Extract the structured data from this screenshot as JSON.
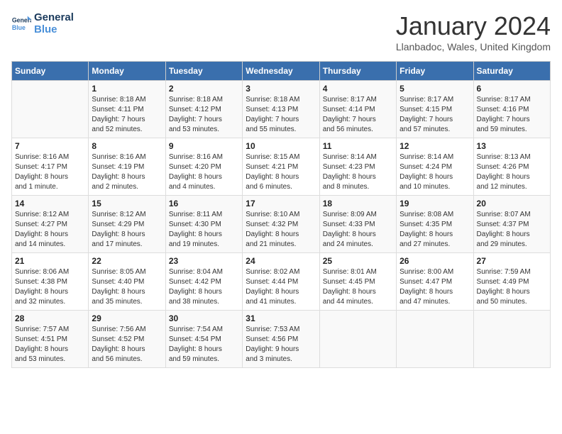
{
  "logo": {
    "line1": "General",
    "line2": "Blue"
  },
  "title": "January 2024",
  "location": "Llanbadoc, Wales, United Kingdom",
  "days_header": [
    "Sunday",
    "Monday",
    "Tuesday",
    "Wednesday",
    "Thursday",
    "Friday",
    "Saturday"
  ],
  "weeks": [
    [
      {
        "num": "",
        "info": ""
      },
      {
        "num": "1",
        "info": "Sunrise: 8:18 AM\nSunset: 4:11 PM\nDaylight: 7 hours\nand 52 minutes."
      },
      {
        "num": "2",
        "info": "Sunrise: 8:18 AM\nSunset: 4:12 PM\nDaylight: 7 hours\nand 53 minutes."
      },
      {
        "num": "3",
        "info": "Sunrise: 8:18 AM\nSunset: 4:13 PM\nDaylight: 7 hours\nand 55 minutes."
      },
      {
        "num": "4",
        "info": "Sunrise: 8:17 AM\nSunset: 4:14 PM\nDaylight: 7 hours\nand 56 minutes."
      },
      {
        "num": "5",
        "info": "Sunrise: 8:17 AM\nSunset: 4:15 PM\nDaylight: 7 hours\nand 57 minutes."
      },
      {
        "num": "6",
        "info": "Sunrise: 8:17 AM\nSunset: 4:16 PM\nDaylight: 7 hours\nand 59 minutes."
      }
    ],
    [
      {
        "num": "7",
        "info": "Sunrise: 8:16 AM\nSunset: 4:17 PM\nDaylight: 8 hours\nand 1 minute."
      },
      {
        "num": "8",
        "info": "Sunrise: 8:16 AM\nSunset: 4:19 PM\nDaylight: 8 hours\nand 2 minutes."
      },
      {
        "num": "9",
        "info": "Sunrise: 8:16 AM\nSunset: 4:20 PM\nDaylight: 8 hours\nand 4 minutes."
      },
      {
        "num": "10",
        "info": "Sunrise: 8:15 AM\nSunset: 4:21 PM\nDaylight: 8 hours\nand 6 minutes."
      },
      {
        "num": "11",
        "info": "Sunrise: 8:14 AM\nSunset: 4:23 PM\nDaylight: 8 hours\nand 8 minutes."
      },
      {
        "num": "12",
        "info": "Sunrise: 8:14 AM\nSunset: 4:24 PM\nDaylight: 8 hours\nand 10 minutes."
      },
      {
        "num": "13",
        "info": "Sunrise: 8:13 AM\nSunset: 4:26 PM\nDaylight: 8 hours\nand 12 minutes."
      }
    ],
    [
      {
        "num": "14",
        "info": "Sunrise: 8:12 AM\nSunset: 4:27 PM\nDaylight: 8 hours\nand 14 minutes."
      },
      {
        "num": "15",
        "info": "Sunrise: 8:12 AM\nSunset: 4:29 PM\nDaylight: 8 hours\nand 17 minutes."
      },
      {
        "num": "16",
        "info": "Sunrise: 8:11 AM\nSunset: 4:30 PM\nDaylight: 8 hours\nand 19 minutes."
      },
      {
        "num": "17",
        "info": "Sunrise: 8:10 AM\nSunset: 4:32 PM\nDaylight: 8 hours\nand 21 minutes."
      },
      {
        "num": "18",
        "info": "Sunrise: 8:09 AM\nSunset: 4:33 PM\nDaylight: 8 hours\nand 24 minutes."
      },
      {
        "num": "19",
        "info": "Sunrise: 8:08 AM\nSunset: 4:35 PM\nDaylight: 8 hours\nand 27 minutes."
      },
      {
        "num": "20",
        "info": "Sunrise: 8:07 AM\nSunset: 4:37 PM\nDaylight: 8 hours\nand 29 minutes."
      }
    ],
    [
      {
        "num": "21",
        "info": "Sunrise: 8:06 AM\nSunset: 4:38 PM\nDaylight: 8 hours\nand 32 minutes."
      },
      {
        "num": "22",
        "info": "Sunrise: 8:05 AM\nSunset: 4:40 PM\nDaylight: 8 hours\nand 35 minutes."
      },
      {
        "num": "23",
        "info": "Sunrise: 8:04 AM\nSunset: 4:42 PM\nDaylight: 8 hours\nand 38 minutes."
      },
      {
        "num": "24",
        "info": "Sunrise: 8:02 AM\nSunset: 4:44 PM\nDaylight: 8 hours\nand 41 minutes."
      },
      {
        "num": "25",
        "info": "Sunrise: 8:01 AM\nSunset: 4:45 PM\nDaylight: 8 hours\nand 44 minutes."
      },
      {
        "num": "26",
        "info": "Sunrise: 8:00 AM\nSunset: 4:47 PM\nDaylight: 8 hours\nand 47 minutes."
      },
      {
        "num": "27",
        "info": "Sunrise: 7:59 AM\nSunset: 4:49 PM\nDaylight: 8 hours\nand 50 minutes."
      }
    ],
    [
      {
        "num": "28",
        "info": "Sunrise: 7:57 AM\nSunset: 4:51 PM\nDaylight: 8 hours\nand 53 minutes."
      },
      {
        "num": "29",
        "info": "Sunrise: 7:56 AM\nSunset: 4:52 PM\nDaylight: 8 hours\nand 56 minutes."
      },
      {
        "num": "30",
        "info": "Sunrise: 7:54 AM\nSunset: 4:54 PM\nDaylight: 8 hours\nand 59 minutes."
      },
      {
        "num": "31",
        "info": "Sunrise: 7:53 AM\nSunset: 4:56 PM\nDaylight: 9 hours\nand 3 minutes."
      },
      {
        "num": "",
        "info": ""
      },
      {
        "num": "",
        "info": ""
      },
      {
        "num": "",
        "info": ""
      }
    ]
  ]
}
